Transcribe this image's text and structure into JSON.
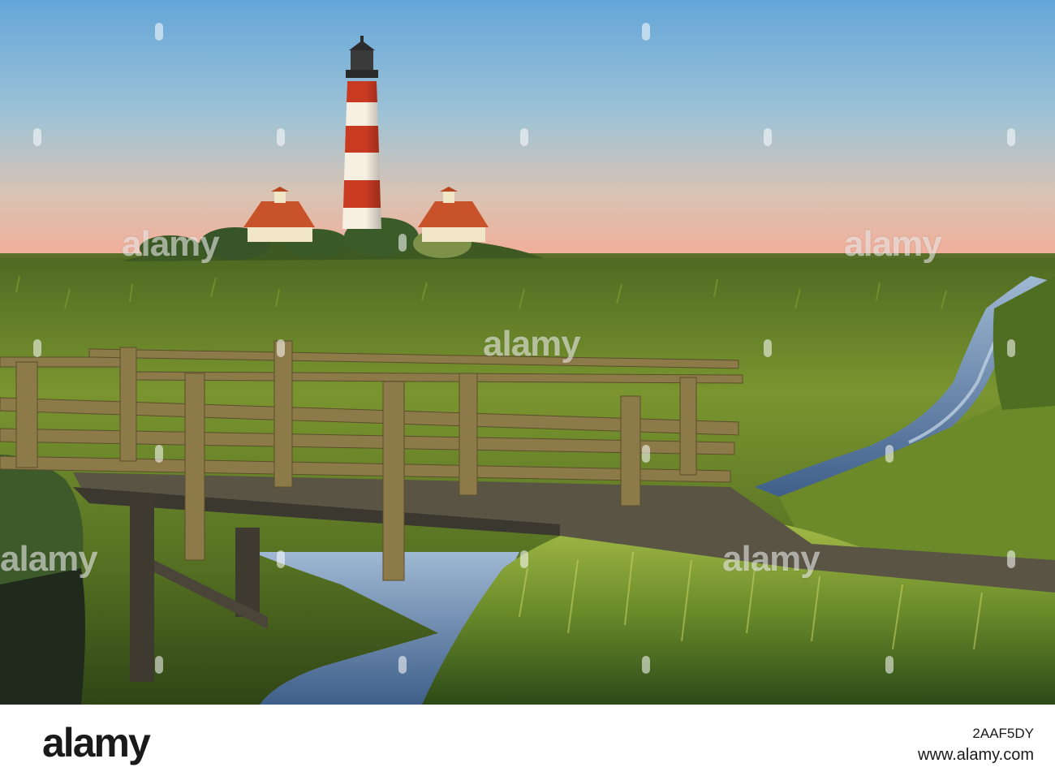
{
  "photo": {
    "subject": "Westerheversand lighthouse with two keeper houses behind salt-marsh grassland, wooden footbridge over a tidal creek at sunset",
    "colors": {
      "sky_top": "#6fa8d8",
      "sky_horizon": "#f2b49a",
      "marsh": "#6f8a2c",
      "tower_red": "#c83a22",
      "tower_white": "#f6efe2",
      "roof": "#c0481f",
      "creek": "#5a7ea8"
    }
  },
  "watermark": {
    "text": "alamy"
  },
  "footer": {
    "logo": "alamy",
    "credit_line": "www.alamy.com",
    "image_id": "2AAF5DY"
  }
}
